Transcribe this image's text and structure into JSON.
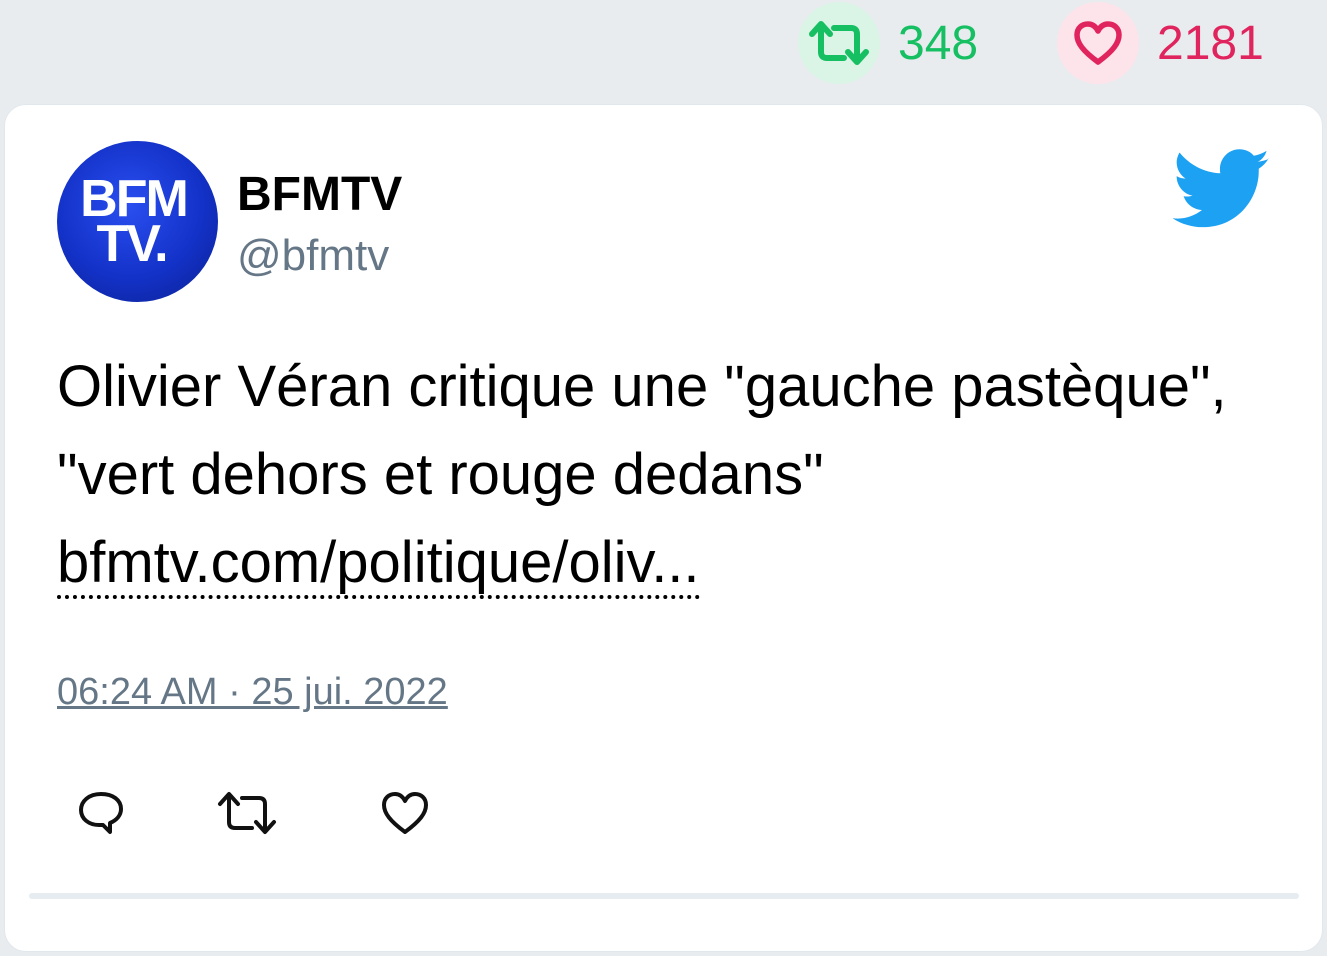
{
  "stats": {
    "retweets": "348",
    "likes": "2181",
    "retweet_color": "#17bf63",
    "like_color": "#e0245e"
  },
  "tweet": {
    "author": {
      "name": "BFMTV",
      "handle": "@bfmtv",
      "avatar_line1": "BFM",
      "avatar_line2": "TV."
    },
    "text_line1": "Olivier Véran critique une \"gauche pastèque\", \"vert dehors et rouge dedans\"",
    "link": "bfmtv.com/politique/oliv...",
    "timestamp": "06:24 AM · 25 jui. 2022",
    "icons": [
      "retweet-icon",
      "heart-icon",
      "twitter-bird-icon",
      "reply-icon"
    ]
  }
}
